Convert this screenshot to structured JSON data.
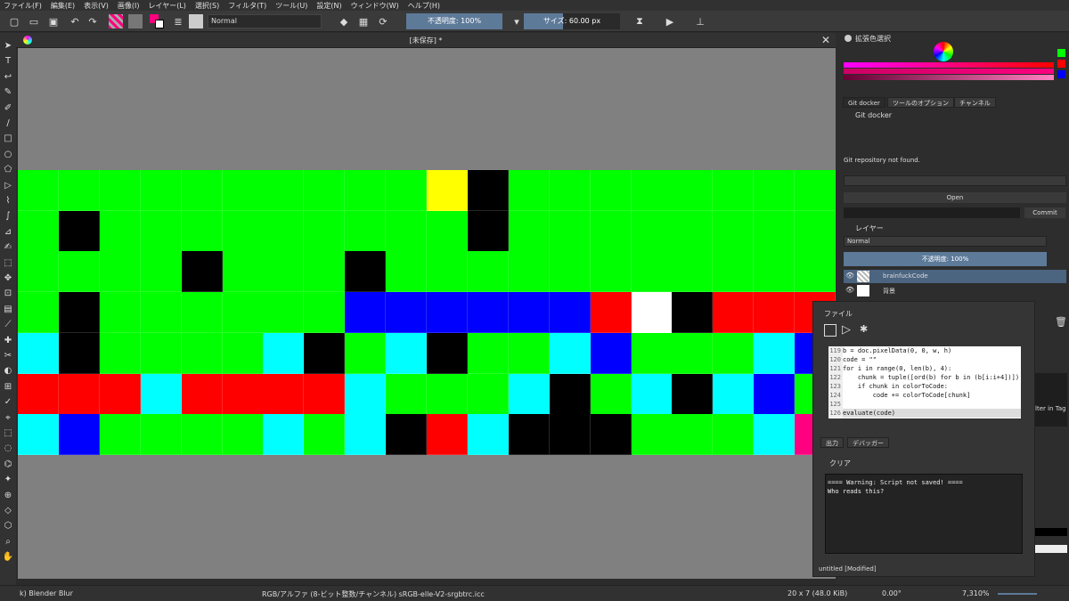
{
  "menu": [
    "ファイル(F)",
    "編集(E)",
    "表示(V)",
    "画像(I)",
    "レイヤー(L)",
    "選択(S)",
    "フィルタ(T)",
    "ツール(U)",
    "設定(N)",
    "ウィンドウ(W)",
    "ヘルプ(H)"
  ],
  "toolbar": {
    "blend_mode": "Normal",
    "opacity_label": "不透明度: 100%",
    "size_label": "サイズ: 60.00 px",
    "colors": {
      "fg": "#ff007f",
      "bg": "#ffffff",
      "accent": "#5d7a99"
    }
  },
  "document": {
    "title": "[未保存] *"
  },
  "canvas": {
    "colors": {
      "G": "#00ff00",
      "K": "#000000",
      "Y": "#ffff00",
      "B": "#0000ff",
      "R": "#ff0000",
      "W": "#ffffff",
      "C": "#00ffff",
      "M": "#ff0080"
    },
    "rows": [
      "GGGGGGGGGGYKGGGGGGGG",
      "GKGGGGGGGGGKGGGGGGGG",
      "GGGGKGGGKGGGGGGGGGGG",
      "GKGGGGGGBBBBBBRWKRRR",
      "CKGGGGCKGCKGGCBGGGCB",
      "RRRCRRRRCGGGCKGCKCBG",
      "CBGGGGCGCKRCKKKGGGCM"
    ]
  },
  "color_selector": {
    "title": "拡張色選択"
  },
  "dock_tabs": [
    "Git docker",
    "ツールのオプション",
    "チャンネル"
  ],
  "git": {
    "title": "Git docker",
    "status": "Git repository not found.",
    "open_label": "Open",
    "commit_label": "Commit"
  },
  "layers": {
    "title": "レイヤー",
    "blend_mode": "Normal",
    "opacity_label": "不透明度: 100%",
    "items": [
      {
        "name": "brainfuckCode"
      },
      {
        "name": "背景"
      }
    ]
  },
  "scripter": {
    "menu_label": "ファイル",
    "code_lines": [
      {
        "n": "119",
        "text": "b = doc.pixelData(0, 0, w, h)"
      },
      {
        "n": "120",
        "text": "code = \"\""
      },
      {
        "n": "121",
        "text": "for i in range(0, len(b), 4):"
      },
      {
        "n": "122",
        "text": "    chunk = tuple([ord(b) for b in (b[i:i+4])])"
      },
      {
        "n": "123",
        "text": "    if chunk in colorToCode:"
      },
      {
        "n": "124",
        "text": "        code += colorToCode[chunk]"
      },
      {
        "n": "125",
        "text": ""
      },
      {
        "n": "126",
        "text": "evaluate(code)"
      }
    ],
    "tabs": [
      "出力",
      "デバッガー"
    ],
    "clear_label": "クリア",
    "output_lines": [
      "==== Warning: Script not saved! ====",
      "Who reads this?"
    ],
    "status": "untitled [Modified]"
  },
  "misc": {
    "filter_in_tag": "lter in Tag"
  },
  "status": {
    "brush": "k) Blender Blur",
    "colorspace": "RGB/アルファ (8-ビット整数/チャンネル)  sRGB-elle-V2-srgbtrc.icc",
    "dimensions": "20 x 7 (48.0 KiB)",
    "rotation": "0.00°",
    "zoom": "7,310%"
  }
}
